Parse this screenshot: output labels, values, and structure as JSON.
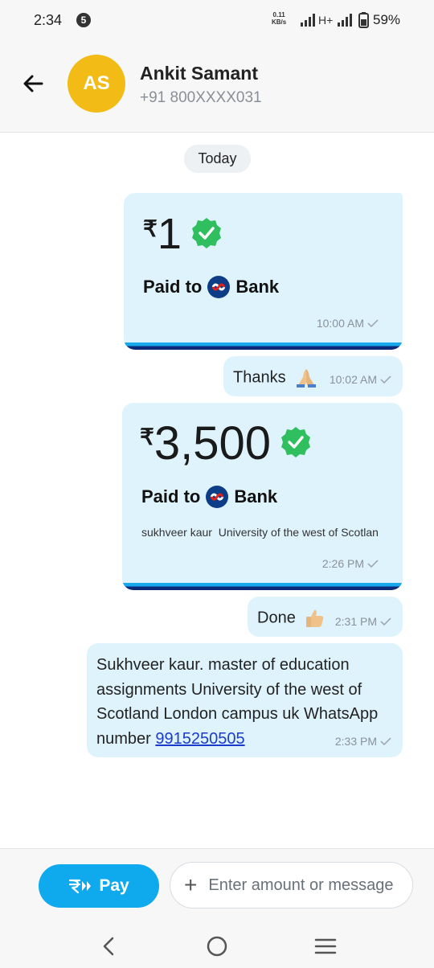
{
  "status_bar": {
    "time": "2:34",
    "notification_count": "5",
    "speed_value": "0.11",
    "speed_unit": "KB/s",
    "network": "H+",
    "battery": "59%"
  },
  "contact": {
    "initials": "AS",
    "name": "Ankit Samant",
    "phone": "+91 800XXXX031",
    "avatar_color": "#f2bb15"
  },
  "chat": {
    "date_label": "Today",
    "messages": [
      {
        "type": "payment",
        "currency": "₹",
        "amount": "1",
        "paid_to_label": "Paid to",
        "bank_label": "Bank",
        "note": "",
        "time": "10:00 AM"
      },
      {
        "type": "text",
        "text": "Thanks",
        "emoji": "folded-hands",
        "time": "10:02 AM"
      },
      {
        "type": "payment",
        "currency": "₹",
        "amount": "3,500",
        "paid_to_label": "Paid to",
        "bank_label": "Bank",
        "note": "sukhveer kaur  University of the west of Scotlan",
        "time": "2:26 PM"
      },
      {
        "type": "text",
        "text": "Done",
        "emoji": "thumbs-up",
        "time": "2:31 PM"
      },
      {
        "type": "text",
        "text": "Sukhveer kaur. master of education assignments University of the west of Scotland London campus uk WhatsApp number ",
        "link": "9915250505",
        "time": "2:33 PM"
      }
    ]
  },
  "composer": {
    "pay_label": "Pay",
    "placeholder": "Enter amount or message"
  },
  "colors": {
    "bubble": "#dff3fd",
    "accent": "#0fa9ee",
    "verified": "#2fbf5f",
    "stripe_top": "#18a8ec",
    "stripe_bottom": "#0c2a78"
  }
}
